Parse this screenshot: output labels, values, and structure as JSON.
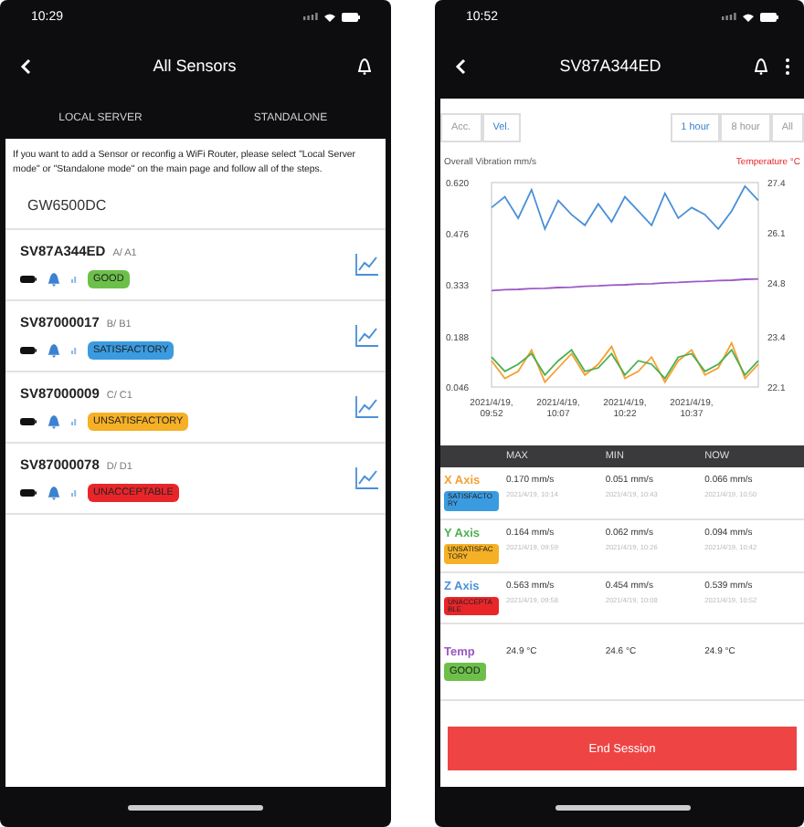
{
  "screens": [
    {
      "kind": "list",
      "status_bar": {
        "time": "10:29"
      },
      "header": {
        "title": "All Sensors"
      },
      "tabs": [
        {
          "label": "LOCAL SERVER"
        },
        {
          "label": "STANDALONE"
        }
      ],
      "info": "If you want to add a Sensor or reconfig a WiFi Router, please select \"Local Server mode\" or \"Standalone mode\" on the main page and follow all of the steps.",
      "gateway": "GW6500DC",
      "sensors": [
        {
          "name": "SV87A344ED",
          "location": "A/ A1",
          "status": "GOOD",
          "color": "#6cc04a"
        },
        {
          "name": "SV87000017",
          "location": "B/ B1",
          "status": "SATISFACTORY",
          "color": "#3b9be0"
        },
        {
          "name": "SV87000009",
          "location": "C/ C1",
          "status": "UNSATISFACTORY",
          "color": "#f5b025"
        },
        {
          "name": "SV87000078",
          "location": "D/ D1",
          "status": "UNACCEPTABLE",
          "color": "#e8262a"
        }
      ]
    },
    {
      "kind": "detail",
      "status_bar": {
        "time": "10:52"
      },
      "header": {
        "title": "SV87A344ED"
      },
      "modes": [
        {
          "label": "Acc.",
          "selected": false
        },
        {
          "label": "Vel.",
          "selected": true
        }
      ],
      "ranges": [
        {
          "label": "1 hour",
          "selected": true
        },
        {
          "label": "8 hour",
          "selected": false
        },
        {
          "label": "All",
          "selected": false
        }
      ],
      "chart": {
        "left_title": "Overall Vibration mm/s",
        "right_title": "Temperature °C",
        "chart_data": {
          "type": "line",
          "categories": [
            "2021/4/19, 09:52",
            null,
            null,
            null,
            null,
            "2021/4/19, 10:07",
            null,
            null,
            null,
            null,
            "2021/4/19, 10:22",
            null,
            null,
            null,
            null,
            "2021/4/19, 10:37",
            null,
            null,
            null,
            null,
            null
          ],
          "ylim": [
            0.046,
            0.62
          ],
          "y2lim": [
            22.1,
            27.4
          ],
          "yticks": [
            {
              "value": 0.62,
              "label": "0.620"
            },
            {
              "value": 0.476,
              "label": "0.476"
            },
            {
              "value": 0.333,
              "label": "0.333"
            },
            {
              "value": 0.188,
              "label": "0.188"
            },
            {
              "value": 0.046,
              "label": "0.046"
            }
          ],
          "y2ticks": [
            {
              "value": 27.4,
              "label": "27.4"
            },
            {
              "value": 26.1,
              "label": "26.1"
            },
            {
              "value": 24.8,
              "label": "24.8"
            },
            {
              "value": 23.4,
              "label": "23.4"
            },
            {
              "value": 22.1,
              "label": "22.1"
            }
          ],
          "series": [
            {
              "color": "#4a90d9",
              "values": [
                0.55,
                0.58,
                0.52,
                0.6,
                0.49,
                0.57,
                0.53,
                0.5,
                0.56,
                0.51,
                0.58,
                0.54,
                0.5,
                0.59,
                0.52,
                0.55,
                0.53,
                0.49,
                0.54,
                0.61,
                0.57
              ]
            },
            {
              "color": "#9b59c6",
              "axis": "y2",
              "values": [
                24.6,
                24.62,
                24.63,
                24.65,
                24.66,
                24.68,
                24.69,
                24.71,
                24.72,
                24.74,
                24.75,
                24.77,
                24.78,
                24.8,
                24.81,
                24.83,
                24.84,
                24.86,
                24.87,
                24.89,
                24.9
              ]
            },
            {
              "color": "#f5a033",
              "values": [
                0.12,
                0.07,
                0.09,
                0.15,
                0.06,
                0.1,
                0.14,
                0.08,
                0.11,
                0.16,
                0.07,
                0.09,
                0.13,
                0.06,
                0.12,
                0.15,
                0.08,
                0.1,
                0.17,
                0.07,
                0.11
              ]
            },
            {
              "color": "#4cb050",
              "values": [
                0.13,
                0.09,
                0.11,
                0.14,
                0.08,
                0.12,
                0.15,
                0.09,
                0.1,
                0.14,
                0.08,
                0.12,
                0.11,
                0.07,
                0.13,
                0.14,
                0.09,
                0.11,
                0.15,
                0.08,
                0.12
              ]
            }
          ]
        }
      },
      "table": {
        "columns": [
          "MAX",
          "MIN",
          "NOW"
        ],
        "rows": [
          {
            "label": {
              "text": "X Axis",
              "color": "#f5a033"
            },
            "badge": {
              "text": "SATISFACTORY",
              "color": "#3b9be0"
            },
            "cells": [
              {
                "value": "0.170 mm/s",
                "time": "2021/4/19, 10:14"
              },
              {
                "value": "0.051 mm/s",
                "time": "2021/4/19, 10:43"
              },
              {
                "value": "0.066 mm/s",
                "time": "2021/4/19, 10:50"
              }
            ]
          },
          {
            "label": {
              "text": "Y Axis",
              "color": "#4cb050"
            },
            "badge": {
              "text": "UNSATISFACTORY",
              "color": "#f5b025"
            },
            "cells": [
              {
                "value": "0.164 mm/s",
                "time": "2021/4/19, 09:59"
              },
              {
                "value": "0.062 mm/s",
                "time": "2021/4/19, 10:26"
              },
              {
                "value": "0.094 mm/s",
                "time": "2021/4/19, 10:42"
              }
            ]
          },
          {
            "label": {
              "text": "Z Axis",
              "color": "#4a90d9"
            },
            "badge": {
              "text": "UNACCEPTABLE",
              "color": "#e8262a"
            },
            "cells": [
              {
                "value": "0.563 mm/s",
                "time": "2021/4/19, 09:58"
              },
              {
                "value": "0.454 mm/s",
                "time": "2021/4/19, 10:08"
              },
              {
                "value": "0.539 mm/s",
                "time": "2021/4/19, 10:52"
              }
            ]
          },
          {
            "label": {
              "text": "Temp",
              "color": "#9b59c6"
            },
            "badge": {
              "text": "GOOD",
              "color": "#6cc04a"
            },
            "cells": [
              {
                "value": "24.9 °C"
              },
              {
                "value": "24.6 °C"
              },
              {
                "value": "24.9 °C"
              }
            ]
          }
        ]
      },
      "action": "End Session"
    }
  ]
}
